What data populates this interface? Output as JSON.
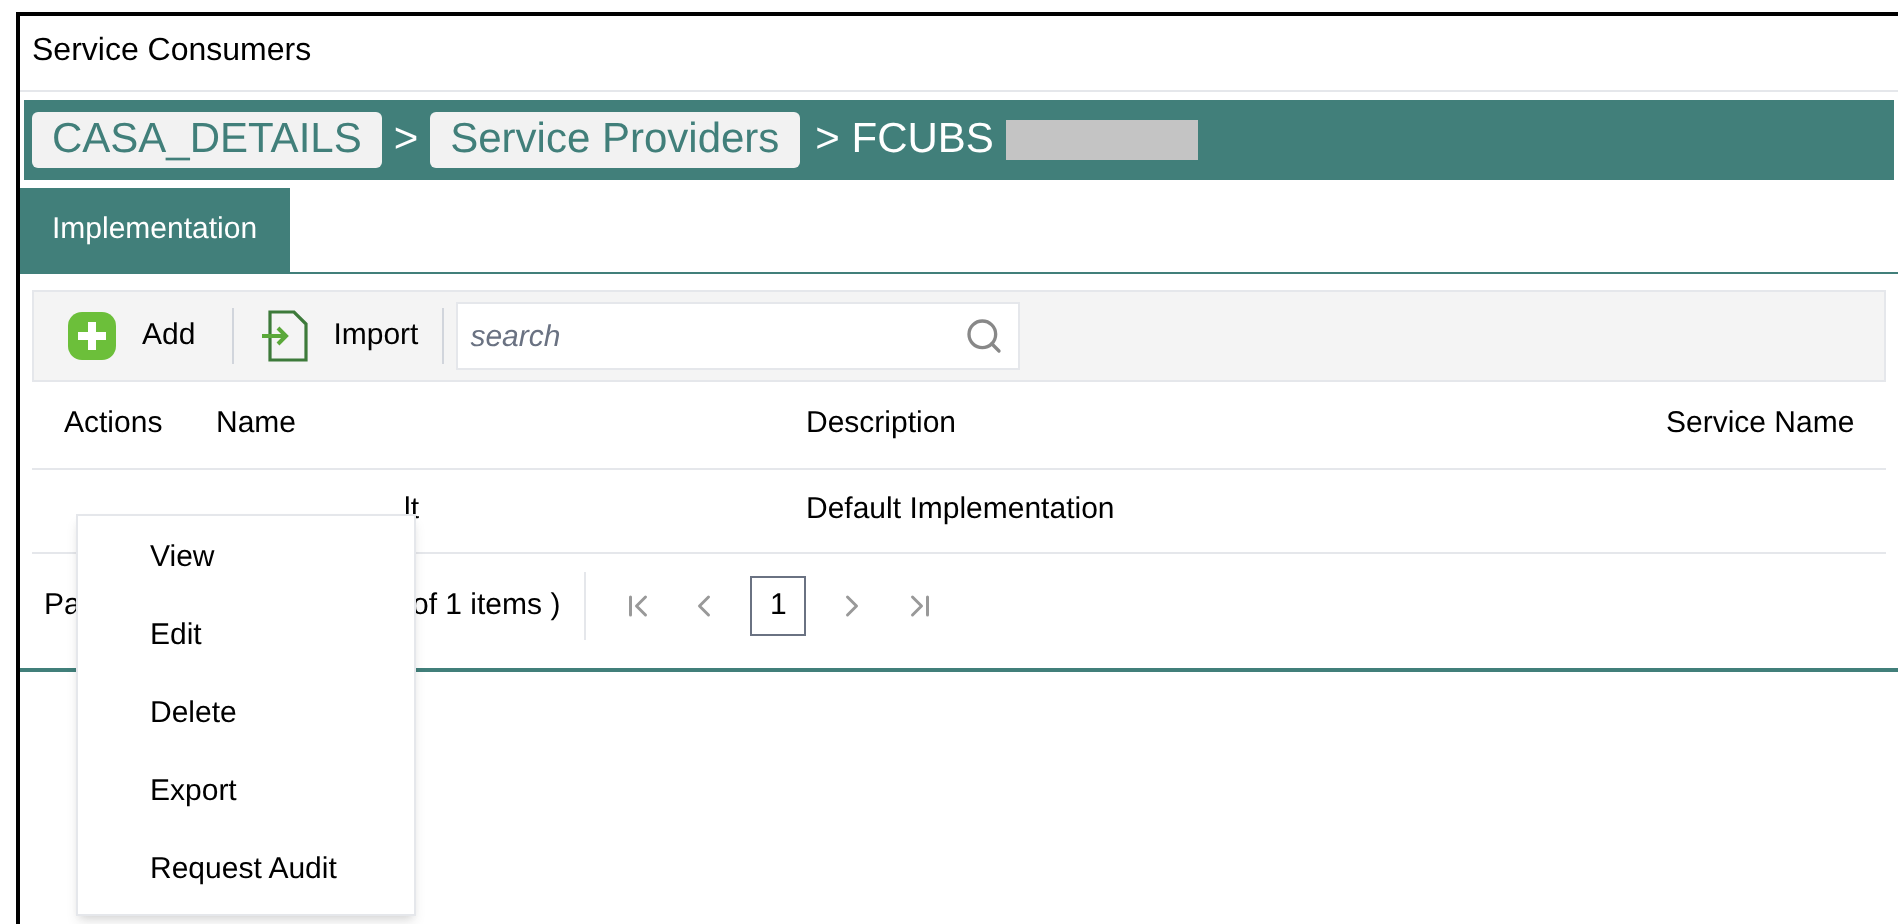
{
  "title": "Service Consumers",
  "breadcrumb": {
    "items": [
      {
        "label": "CASA_DETAILS"
      },
      {
        "label": "Service Providers"
      }
    ],
    "separator": ">",
    "current": "> FCUBS"
  },
  "tabs": [
    {
      "label": "Implementation",
      "selected": true
    }
  ],
  "toolbar": {
    "buttons": [
      {
        "label": "Add",
        "kind": "add"
      },
      {
        "label": "Import",
        "kind": "import"
      }
    ],
    "search": {
      "placeholder": "search"
    }
  },
  "table": {
    "columns": [
      "Actions",
      "Name",
      "Description",
      "Service Name"
    ],
    "rows": [
      {
        "name": "lt",
        "description": "Default Implementation"
      }
    ]
  },
  "pager": {
    "start": "Pa",
    "summary": "of 1 items )",
    "page": "1"
  },
  "context_menu": [
    "View",
    "Edit",
    "Delete",
    "Export",
    "Request Audit"
  ]
}
